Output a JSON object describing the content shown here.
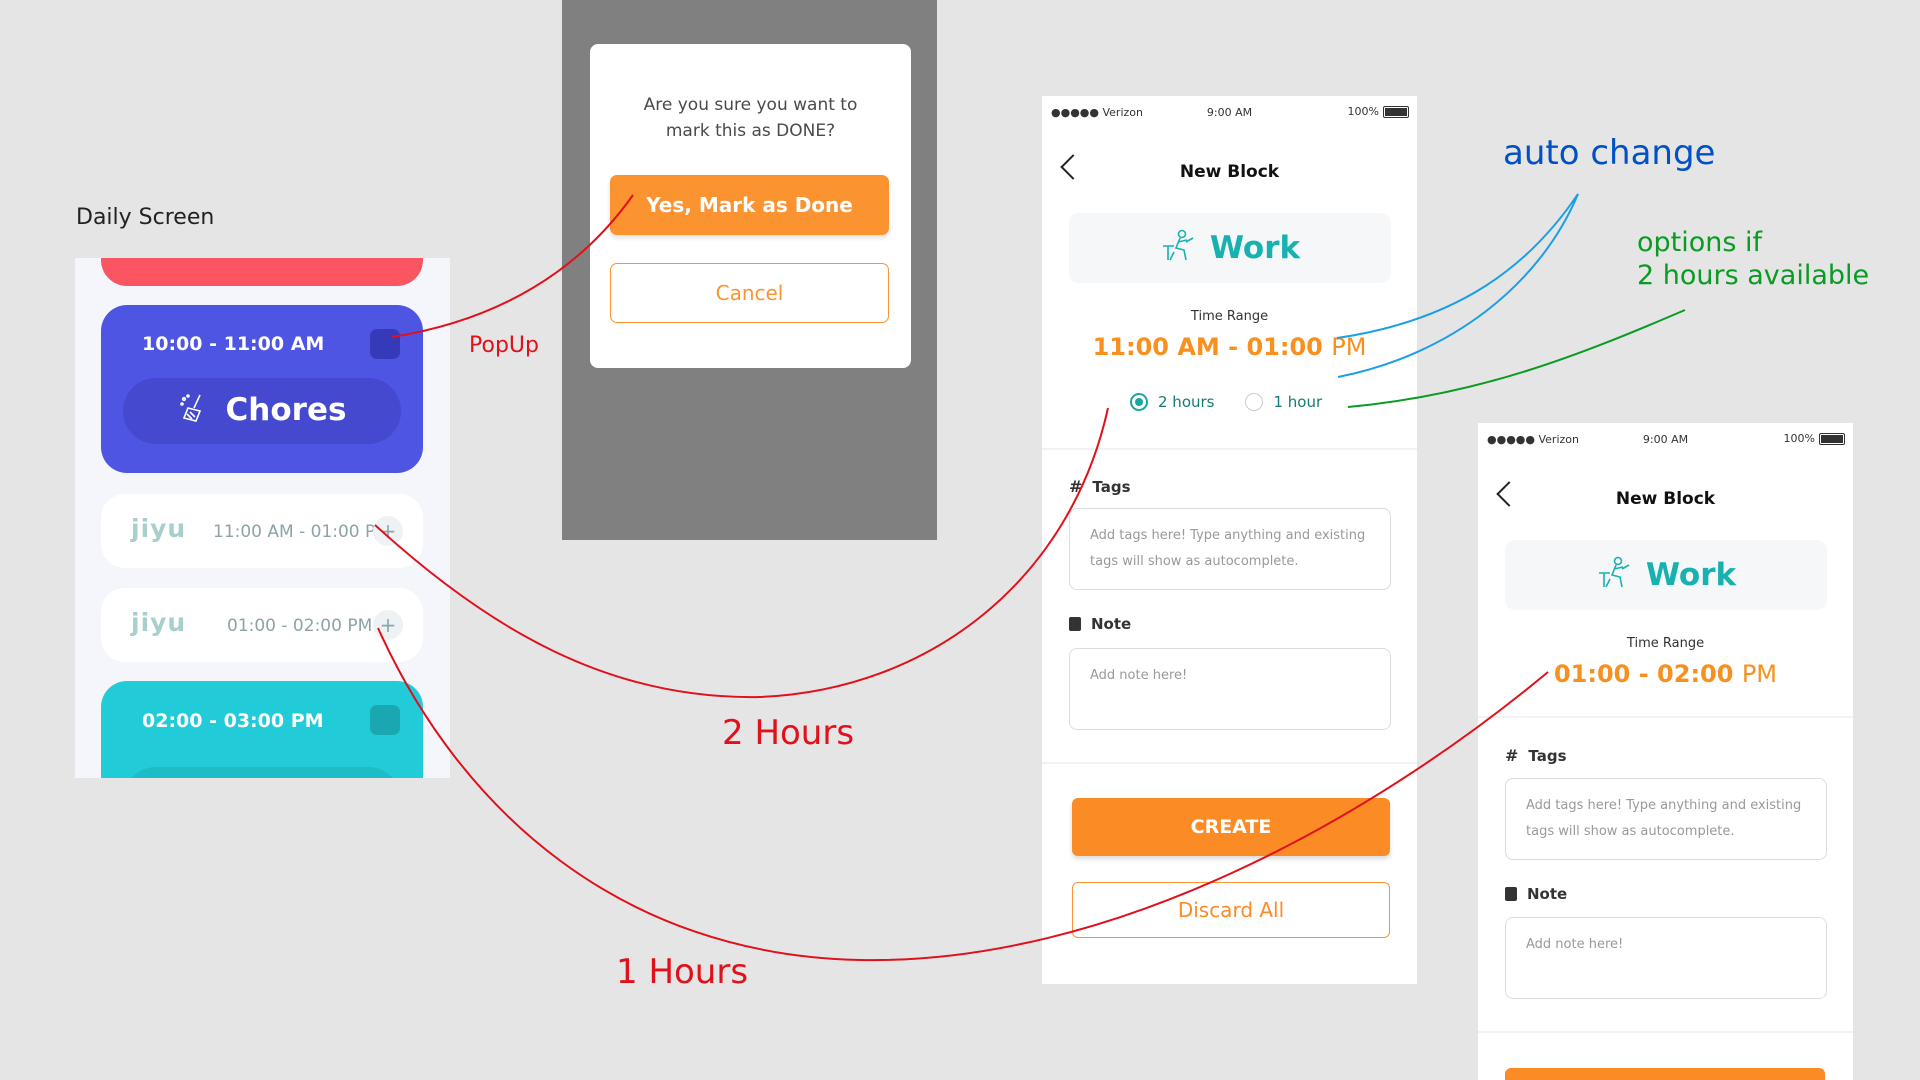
{
  "captions": {
    "daily_screen": "Daily Screen",
    "popup": "PopUp",
    "two_hours": "2 Hours",
    "one_hours": "1 Hours",
    "auto_change": "auto change",
    "options_line1": "options if",
    "options_line2": "2 hours available"
  },
  "colors": {
    "annotation_red": "#e0111b",
    "annotation_blue": "#0051c5",
    "annotation_green": "#0a9b22",
    "orange": "#fb8b24",
    "teal": "#17b2b0"
  },
  "daily": {
    "card1": {
      "time": "10:00 - 11:00 AM",
      "title": "Chores",
      "icon": "broom-icon"
    },
    "slot1": {
      "logo": "jiyu",
      "time": "11:00 AM - 01:00 PM",
      "plus": "+"
    },
    "slot2": {
      "logo": "jiyu",
      "time": "01:00 - 02:00 PM",
      "plus": "+"
    },
    "card2": {
      "time": "02:00 - 03:00 PM"
    }
  },
  "popup": {
    "question_line1": "Are you sure you want to",
    "question_line2": "mark this as DONE?",
    "yes_label": "Yes, Mark as Done",
    "cancel_label": "Cancel"
  },
  "phone1": {
    "status": {
      "carrier": "●●●●● Verizon",
      "time": "9:00 AM",
      "battery": "100%"
    },
    "title": "New Block",
    "category": "Work",
    "time_range_label": "Time Range",
    "time_range_main": "11:00 AM - 01:00 ",
    "time_range_suffix": "PM",
    "option_2h": "2 hours",
    "option_1h": "1 hour",
    "tags_label": "Tags",
    "tags_placeholder": "Add tags here! Type anything and existing tags will show as autocomplete.",
    "note_label": "Note",
    "note_placeholder": "Add note here!",
    "create_label": "CREATE",
    "discard_label": "Discard All"
  },
  "phone2": {
    "status": {
      "carrier": "●●●●● Verizon",
      "time": "9:00 AM",
      "battery": "100%"
    },
    "title": "New Block",
    "category": "Work",
    "time_range_label": "Time Range",
    "time_range_main": "01:00 - 02:00 ",
    "time_range_suffix": "PM",
    "tags_label": "Tags",
    "tags_placeholder": "Add tags here! Type anything and existing tags will show as autocomplete.",
    "note_label": "Note",
    "note_placeholder": "Add note here!"
  }
}
